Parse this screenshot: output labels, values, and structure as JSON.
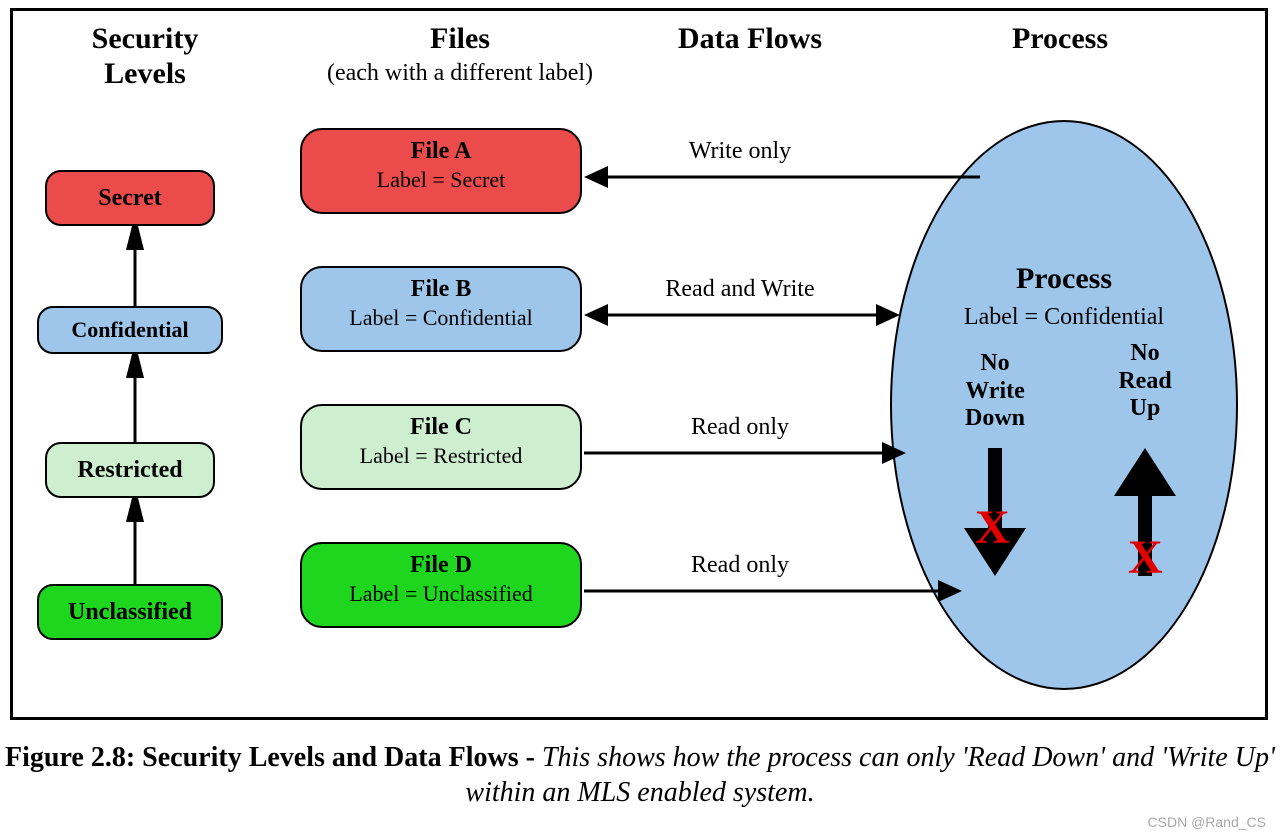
{
  "headers": {
    "security_levels": "Security\nLevels",
    "files": "Files",
    "files_sub": "(each with a different label)",
    "data_flows": "Data Flows",
    "process": "Process"
  },
  "levels": [
    {
      "name": "Secret",
      "fill": "#ec4b4b"
    },
    {
      "name": "Confidential",
      "fill": "#9ec6eb"
    },
    {
      "name": "Restricted",
      "fill": "#cdeecf"
    },
    {
      "name": "Unclassified",
      "fill": "#1fd61f"
    }
  ],
  "files": [
    {
      "name": "File A",
      "label": "Label = Secret",
      "fill": "#ec4b4b"
    },
    {
      "name": "File B",
      "label": "Label = Confidential",
      "fill": "#9ec6eb"
    },
    {
      "name": "File C",
      "label": "Label = Restricted",
      "fill": "#cdeecf"
    },
    {
      "name": "File D",
      "label": "Label = Unclassified",
      "fill": "#1fd61f"
    }
  ],
  "flows": [
    {
      "text": "Write only",
      "direction": "left"
    },
    {
      "text": "Read and Write",
      "direction": "both"
    },
    {
      "text": "Read only",
      "direction": "right"
    },
    {
      "text": "Read only",
      "direction": "right"
    }
  ],
  "process_node": {
    "title": "Process",
    "label": "Label = Confidential",
    "fill": "#9ec6eb",
    "rules": [
      {
        "text": "No\nWrite\nDown",
        "arrow": "down",
        "mark": "X"
      },
      {
        "text": "No\nRead\nUp",
        "arrow": "up",
        "mark": "X"
      }
    ]
  },
  "caption": {
    "bold": "Figure 2.8: Security Levels and Data Flows - ",
    "italic": "This shows how the process can only 'Read Down' and 'Write Up' within an MLS enabled system."
  },
  "watermark": "CSDN @Rand_CS"
}
